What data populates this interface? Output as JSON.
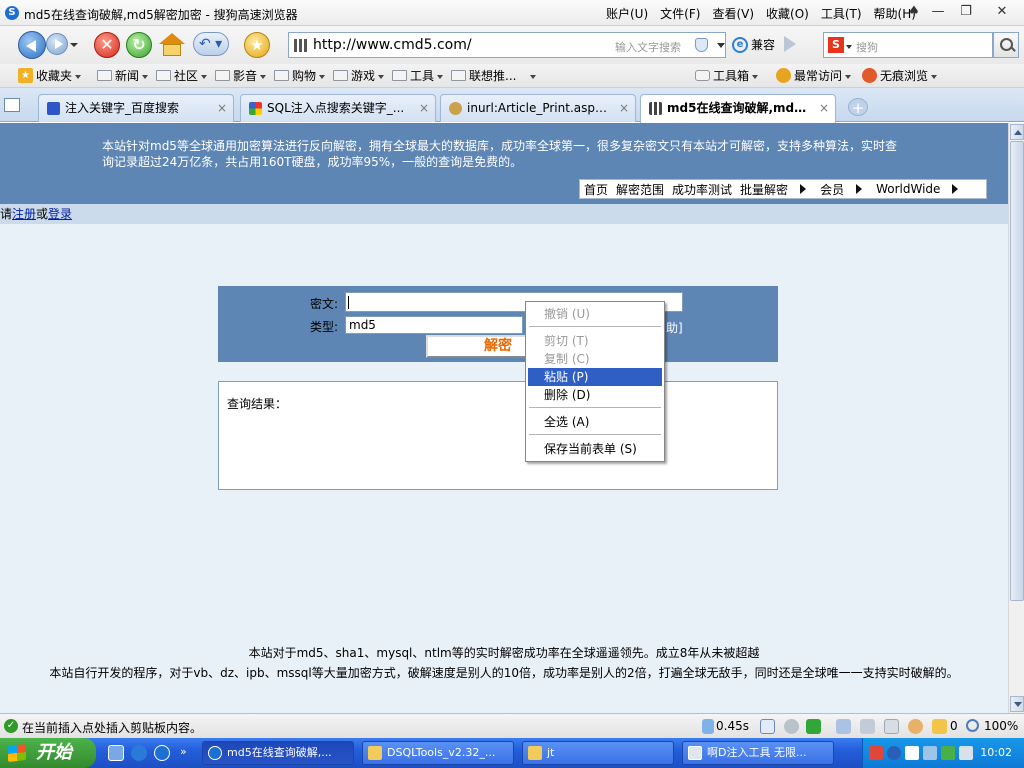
{
  "window": {
    "title": "md5在线查询破解,md5解密加密 - 搜狗高速浏览器"
  },
  "menubar": [
    "账户(U)",
    "文件(F)",
    "查看(V)",
    "收藏(O)",
    "工具(T)",
    "帮助(H)"
  ],
  "address": {
    "url": "http://www.cmd5.com/",
    "hint": "输入文字搜索",
    "compat": "兼容"
  },
  "search": {
    "placeholder": "搜狗"
  },
  "bookmarks": {
    "favorites": "收藏夹",
    "folders": [
      "新闻",
      "社区",
      "影音",
      "购物",
      "游戏",
      "工具",
      "联想推..."
    ],
    "right": [
      "工具箱",
      "最常访问",
      "无痕浏览"
    ]
  },
  "tabs": [
    {
      "label": "注入关键字_百度搜索",
      "close": "×"
    },
    {
      "label": "SQL注入点搜索关键字_...",
      "close": "×"
    },
    {
      "label": "inurl:Article_Print.asp?_谷...",
      "close": "×"
    },
    {
      "label": "md5在线查询破解,md5...",
      "close": "×"
    }
  ],
  "banner": {
    "intro": "本站针对md5等全球通用加密算法进行反向解密，拥有全球最大的数据库，成功率全球第一，很多复杂密文只有本站才可解密，支持多种算法，实时查询记录超过24万亿条，共占用160T硬盘，成功率95%，一般的查询是免费的。",
    "nav": [
      "首页",
      "解密范围",
      "成功率测试",
      "批量解密",
      "会员",
      "WorldWide"
    ]
  },
  "login": {
    "prefix": "请",
    "register": "注册",
    "or": "或",
    "login": "登录"
  },
  "form": {
    "cipher_label": "密文:",
    "type_label": "类型:",
    "type_value": "md5",
    "help_suffix": "助]",
    "decrypt_button": "解密"
  },
  "result": {
    "label": "查询结果："
  },
  "footer": {
    "line1": "本站对于md5、sha1、mysql、ntlm等的实时解密成功率在全球遥遥领先。成立8年从未被超越",
    "line2": "本站自行开发的程序，对于vb、dz、ipb、mssql等大量加密方式，破解速度是别人的10倍，成功率是别人的2倍，打遍全球无敌手，同时还是全球唯一一支持实时破解的。"
  },
  "context_menu": {
    "undo": "撤销 (U)",
    "cut": "剪切 (T)",
    "copy": "复制 (C)",
    "paste": "粘贴 (P)",
    "delete": "删除 (D)",
    "select_all": "全选 (A)",
    "save_form": "保存当前表单 (S)"
  },
  "statusbar": {
    "message": "在当前插入点处插入剪贴板内容。",
    "speed": "0.45s",
    "count": "0",
    "zoom": "100%"
  },
  "taskbar": {
    "start": "开始",
    "tasks": [
      "md5在线查询破解,...",
      "DSQLTools_v2.32_...",
      "jt",
      "啊D注入工具 无限..."
    ],
    "clock": "10:02"
  },
  "colors": {
    "banner": "#5e86b4",
    "page_bg": "#e8f0f8",
    "highlight": "#2f5fc5",
    "decrypt_text": "#e86a00"
  }
}
